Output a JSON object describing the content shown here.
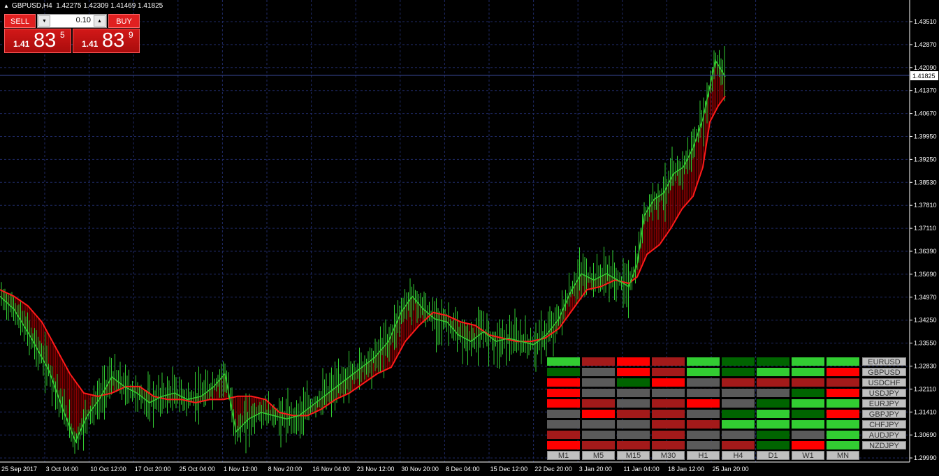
{
  "header": {
    "symbol": "GBPUSD,H4",
    "ohlc": "1.42275 1.42309 1.41469 1.41825"
  },
  "trade_panel": {
    "sell_label": "SELL",
    "buy_label": "BUY",
    "lot": "0.10",
    "sell": {
      "small": "1.41",
      "big": "83",
      "sup": "5"
    },
    "buy": {
      "small": "1.41",
      "big": "83",
      "sup": "9"
    }
  },
  "price_axis": {
    "ticks": [
      "1.43510",
      "1.42870",
      "1.42090",
      "1.41370",
      "1.40670",
      "1.39950",
      "1.39250",
      "1.38530",
      "1.37810",
      "1.37110",
      "1.36390",
      "1.35690",
      "1.34970",
      "1.34250",
      "1.33550",
      "1.32830",
      "1.32110",
      "1.31410",
      "1.30690",
      "1.29990"
    ],
    "current": "1.41825",
    "range": [
      1.2999,
      1.4351
    ]
  },
  "time_axis": [
    "25 Sep 2017",
    "3 Oct 04:00",
    "10 Oct 12:00",
    "17 Oct 20:00",
    "25 Oct 04:00",
    "1 Nov 12:00",
    "8 Nov 20:00",
    "16 Nov 04:00",
    "23 Nov 12:00",
    "30 Nov 20:00",
    "8 Dec 04:00",
    "15 Dec 12:00",
    "22 Dec 20:00",
    "3 Jan 20:00",
    "11 Jan 04:00",
    "18 Jan 12:00",
    "25 Jan 20:00"
  ],
  "colors": {
    "bg": "#000000",
    "grid": "#1f2a66",
    "candle": "#32cd32",
    "trail": "#ff1a1a",
    "fill": "#8b0000"
  },
  "strength_grid": {
    "symbols": [
      "EURUSD",
      "GBPUSD",
      "USDCHF",
      "USDJPY",
      "EURJPY",
      "GBPJPY",
      "CHFJPY",
      "AUDJPY",
      "NZDJPY"
    ],
    "timeframes": [
      "M1",
      "M5",
      "M15",
      "M30",
      "H1",
      "H4",
      "D1",
      "W1",
      "MN"
    ],
    "rows": [
      [
        "#32cd32",
        "#a31a1a",
        "#ff0000",
        "#a31a1a",
        "#32cd32",
        "#006400",
        "#006400",
        "#32cd32",
        "#32cd32"
      ],
      [
        "#006400",
        "#5a5a5a",
        "#ff0000",
        "#a31a1a",
        "#32cd32",
        "#006400",
        "#32cd32",
        "#32cd32",
        "#ff0000"
      ],
      [
        "#ff0000",
        "#5a5a5a",
        "#006400",
        "#ff0000",
        "#5a5a5a",
        "#a31a1a",
        "#a31a1a",
        "#a31a1a",
        "#a31a1a"
      ],
      [
        "#ff0000",
        "#5a5a5a",
        "#5a5a5a",
        "#5a5a5a",
        "#5a5a5a",
        "#5a5a5a",
        "#5a5a5a",
        "#006400",
        "#ff0000"
      ],
      [
        "#ff0000",
        "#a31a1a",
        "#5a5a5a",
        "#a31a1a",
        "#ff0000",
        "#5a5a5a",
        "#006400",
        "#32cd32",
        "#32cd32"
      ],
      [
        "#5a5a5a",
        "#ff0000",
        "#a31a1a",
        "#a31a1a",
        "#5a5a5a",
        "#006400",
        "#32cd32",
        "#006400",
        "#ff0000"
      ],
      [
        "#5a5a5a",
        "#5a5a5a",
        "#5a5a5a",
        "#a31a1a",
        "#a31a1a",
        "#32cd32",
        "#32cd32",
        "#32cd32",
        "#32cd32"
      ],
      [
        "#a31a1a",
        "#5a5a5a",
        "#5a5a5a",
        "#a31a1a",
        "#5a5a5a",
        "#5a5a5a",
        "#006400",
        "#5a5a5a",
        "#32cd32"
      ],
      [
        "#ff0000",
        "#a31a1a",
        "#a31a1a",
        "#a31a1a",
        "#5a5a5a",
        "#a31a1a",
        "#006400",
        "#ff0000",
        "#32cd32"
      ]
    ]
  },
  "price_path": [
    [
      0,
      1.35
    ],
    [
      20,
      1.346
    ],
    [
      45,
      1.337
    ],
    [
      70,
      1.327
    ],
    [
      90,
      1.315
    ],
    [
      108,
      1.305
    ],
    [
      125,
      1.313
    ],
    [
      142,
      1.318
    ],
    [
      160,
      1.325
    ],
    [
      178,
      1.322
    ],
    [
      196,
      1.32
    ],
    [
      214,
      1.317
    ],
    [
      232,
      1.319
    ],
    [
      250,
      1.32
    ],
    [
      268,
      1.318
    ],
    [
      288,
      1.319
    ],
    [
      306,
      1.322
    ],
    [
      322,
      1.326
    ],
    [
      338,
      1.308
    ],
    [
      356,
      1.312
    ],
    [
      374,
      1.314
    ],
    [
      392,
      1.313
    ],
    [
      410,
      1.312
    ],
    [
      428,
      1.313
    ],
    [
      446,
      1.316
    ],
    [
      464,
      1.319
    ],
    [
      482,
      1.322
    ],
    [
      500,
      1.325
    ],
    [
      518,
      1.328
    ],
    [
      536,
      1.331
    ],
    [
      556,
      1.336
    ],
    [
      574,
      1.345
    ],
    [
      590,
      1.35
    ],
    [
      606,
      1.346
    ],
    [
      622,
      1.343
    ],
    [
      640,
      1.342
    ],
    [
      656,
      1.338
    ],
    [
      674,
      1.336
    ],
    [
      692,
      1.339
    ],
    [
      710,
      1.336
    ],
    [
      728,
      1.337
    ],
    [
      746,
      1.336
    ],
    [
      764,
      1.335
    ],
    [
      782,
      1.338
    ],
    [
      800,
      1.343
    ],
    [
      816,
      1.351
    ],
    [
      832,
      1.357
    ],
    [
      850,
      1.355
    ],
    [
      868,
      1.357
    ],
    [
      884,
      1.355
    ],
    [
      900,
      1.353
    ],
    [
      912,
      1.36
    ],
    [
      922,
      1.375
    ],
    [
      936,
      1.38
    ],
    [
      950,
      1.382
    ],
    [
      964,
      1.388
    ],
    [
      978,
      1.39
    ],
    [
      992,
      1.396
    ],
    [
      1006,
      1.405
    ],
    [
      1016,
      1.415
    ],
    [
      1024,
      1.423
    ],
    [
      1030,
      1.421
    ],
    [
      1038,
      1.418
    ]
  ],
  "trail_path": [
    [
      0,
      1.352
    ],
    [
      20,
      1.35
    ],
    [
      40,
      1.347
    ],
    [
      60,
      1.342
    ],
    [
      80,
      1.334
    ],
    [
      100,
      1.326
    ],
    [
      120,
      1.32
    ],
    [
      140,
      1.319
    ],
    [
      160,
      1.32
    ],
    [
      180,
      1.322
    ],
    [
      200,
      1.322
    ],
    [
      220,
      1.319
    ],
    [
      240,
      1.318
    ],
    [
      260,
      1.318
    ],
    [
      280,
      1.317
    ],
    [
      300,
      1.318
    ],
    [
      320,
      1.318
    ],
    [
      340,
      1.319
    ],
    [
      360,
      1.319
    ],
    [
      380,
      1.318
    ],
    [
      400,
      1.314
    ],
    [
      420,
      1.313
    ],
    [
      440,
      1.313
    ],
    [
      460,
      1.315
    ],
    [
      480,
      1.318
    ],
    [
      500,
      1.32
    ],
    [
      520,
      1.323
    ],
    [
      540,
      1.326
    ],
    [
      560,
      1.328
    ],
    [
      580,
      1.336
    ],
    [
      600,
      1.341
    ],
    [
      620,
      1.345
    ],
    [
      640,
      1.344
    ],
    [
      660,
      1.342
    ],
    [
      680,
      1.341
    ],
    [
      700,
      1.338
    ],
    [
      720,
      1.337
    ],
    [
      740,
      1.336
    ],
    [
      760,
      1.336
    ],
    [
      780,
      1.337
    ],
    [
      800,
      1.34
    ],
    [
      820,
      1.346
    ],
    [
      840,
      1.352
    ],
    [
      860,
      1.353
    ],
    [
      880,
      1.355
    ],
    [
      900,
      1.354
    ],
    [
      912,
      1.356
    ],
    [
      926,
      1.363
    ],
    [
      944,
      1.366
    ],
    [
      960,
      1.371
    ],
    [
      976,
      1.377
    ],
    [
      992,
      1.381
    ],
    [
      1006,
      1.39
    ],
    [
      1016,
      1.404
    ],
    [
      1028,
      1.409
    ],
    [
      1038,
      1.412
    ]
  ]
}
